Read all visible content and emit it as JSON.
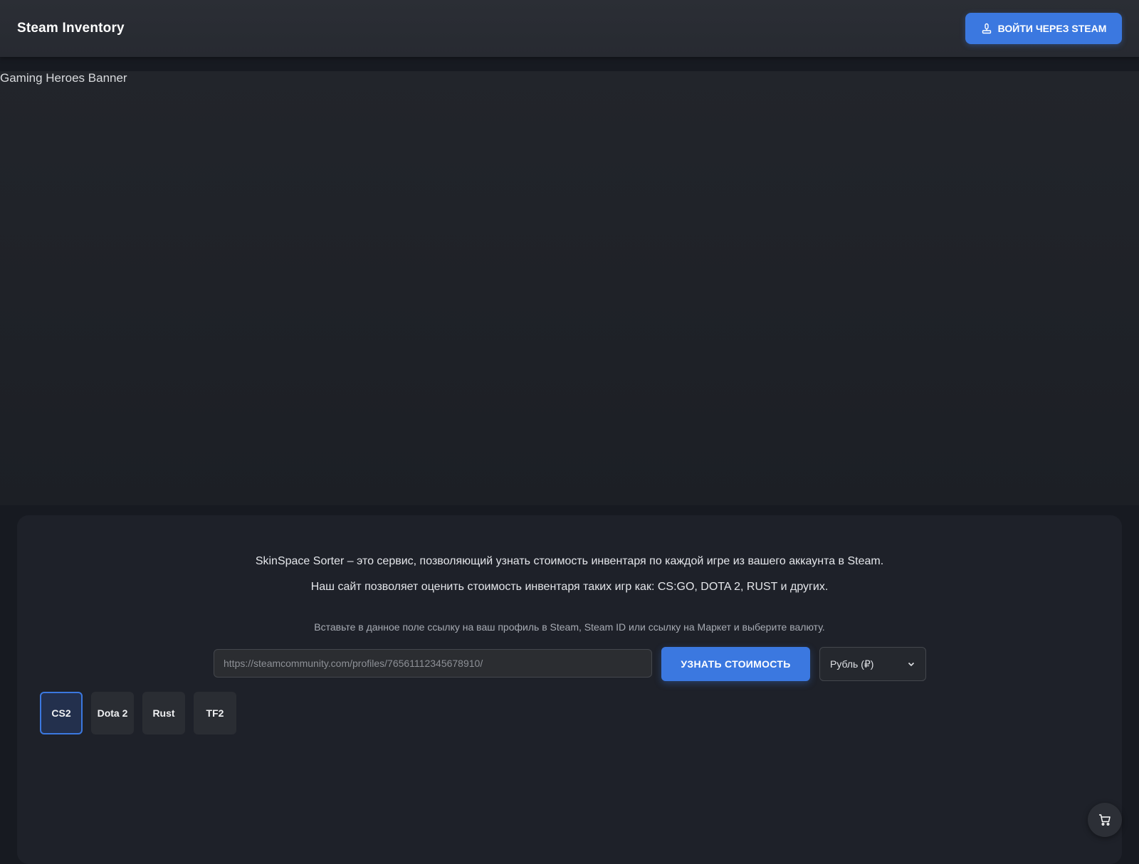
{
  "header": {
    "brand": "Steam Inventory",
    "login_label": "ВОЙТИ ЧЕРЕЗ STEAM",
    "login_icon": "steam-joystick-icon"
  },
  "banner": {
    "alt_text": "Gaming Heroes Banner"
  },
  "main": {
    "description_line1": "SkinSpace Sorter – это сервис, позволяющий узнать стоимость инвентаря по каждой игре из вашего аккаунта в Steam.",
    "description_line2": "Наш сайт позволяет оценить стоимость инвентаря таких игр как: CS:GO, DOTA 2, RUST и других.",
    "hint": "Вставьте в данное поле ссылку на ваш профиль в Steam, Steam ID или ссылку на Маркет и выберите валюту.",
    "url_input": {
      "placeholder": "https://steamcommunity.com/profiles/76561112345678910/",
      "value": ""
    },
    "price_button_label": "УЗНАТЬ СТОИМОСТЬ",
    "currency": {
      "selected": "Рубль (₽)",
      "icon": "chevron-down-icon"
    },
    "games": [
      {
        "label": "CS2",
        "active": true
      },
      {
        "label": "Dota 2",
        "active": false
      },
      {
        "label": "Rust",
        "active": false
      },
      {
        "label": "TF2",
        "active": false
      }
    ]
  },
  "cart": {
    "icon": "cart-icon"
  },
  "colors": {
    "accent": "#3b78e0",
    "background": "#171a21",
    "panel": "#1e2129",
    "header": "#2b2e35"
  }
}
